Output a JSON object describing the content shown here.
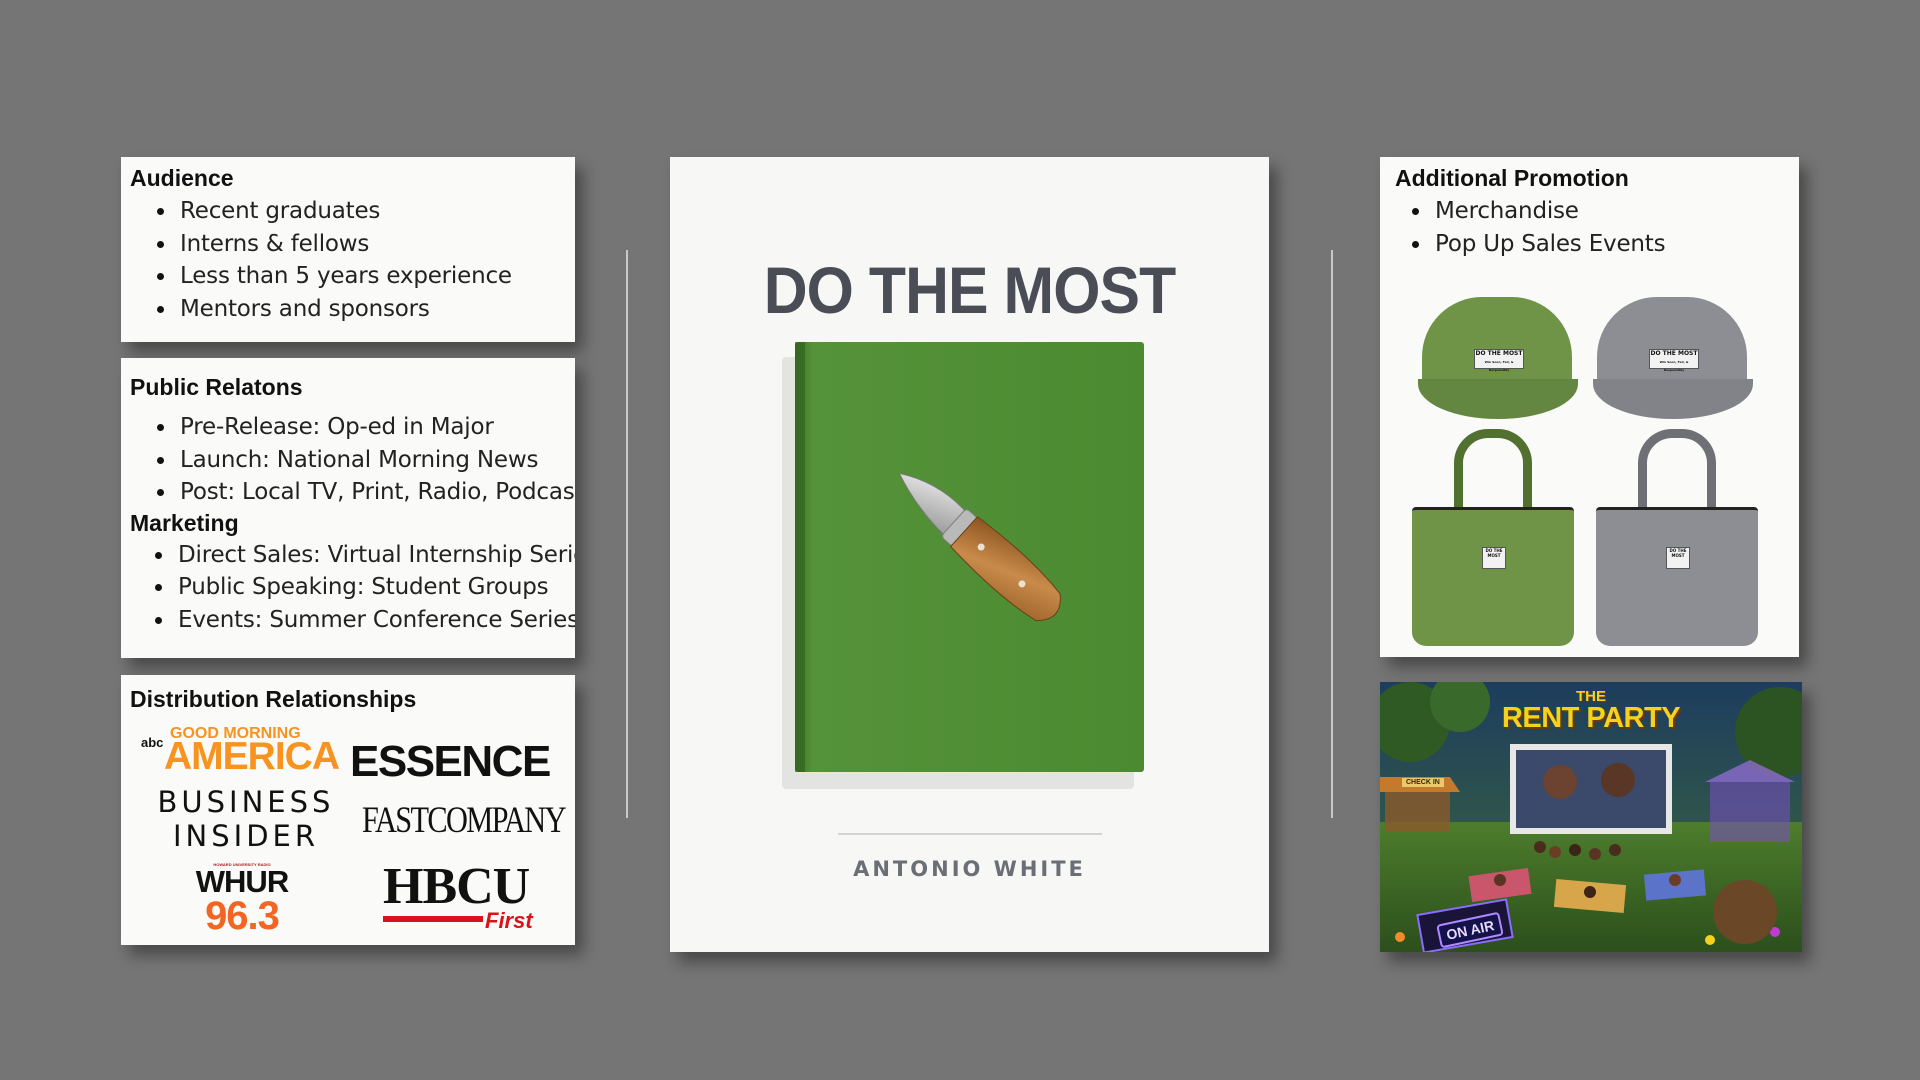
{
  "audience": {
    "title": "Audience",
    "items": [
      "Recent graduates",
      "Interns & fellows",
      "Less than 5 years experience",
      "Mentors and sponsors"
    ]
  },
  "pr_marketing": {
    "pr_title": "Public Relatons",
    "pr_items": [
      "Pre-Release: Op-ed in Major",
      "Launch: National Morning News",
      "Post: Local TV, Print, Radio, Podcast"
    ],
    "marketing_title": "Marketing",
    "marketing_items": [
      "Direct Sales: Virtual Internship Series",
      "Public Speaking: Student Groups",
      "Events: Summer Conference Series"
    ]
  },
  "distribution": {
    "title": "Distribution Relationships",
    "logos": {
      "gma_abc": "abc",
      "gma_top": "GOOD MORNING",
      "gma_bottom": "AMERICA",
      "essence": "ESSENCE",
      "bi_top": "BUSINESS",
      "bi_bottom": "INSIDER",
      "fastcompany": "FASTCOMPANY",
      "whur_tag": "HOWARD UNIVERSITY RADIO",
      "whur_top": "WHUR",
      "whur_bottom": "96.3",
      "hbcu_top": "HBCU",
      "hbcu_bottom": "First"
    }
  },
  "cover": {
    "title": "DO THE MOST",
    "author": "ANTONIO WHITE"
  },
  "promotion": {
    "title": "Additional Promotion",
    "items": [
      "Merchandise",
      "Pop Up Sales Events"
    ],
    "tag_text": "DO THE MOST",
    "tag_sub": "Win Soon, Fail, & Responsibly"
  },
  "rent_party": {
    "title_small": "THE",
    "title_big": "RENT PARTY",
    "sign": "CHECK IN",
    "on_air": "ON AIR"
  },
  "colors": {
    "background": "#757575",
    "book_green": "#4f8a34",
    "merch_green": "#6f9448",
    "merch_gray": "#8c8e93",
    "gma_orange": "#f7931e",
    "hbcu_red": "#d7141a",
    "rent_yellow": "#f5d21c"
  }
}
